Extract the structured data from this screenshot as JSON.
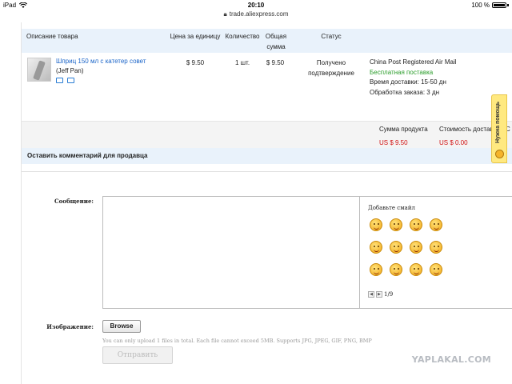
{
  "status_bar": {
    "device": "iPad",
    "time": "20:10",
    "battery": "100 %",
    "url": "trade.aliexpress.com"
  },
  "table": {
    "headers": {
      "description": "Описание товара",
      "unit_price": "Цена за единицу",
      "quantity": "Количество",
      "total_line1": "Общая",
      "total_line2": "сумма",
      "status": "Статус"
    },
    "row": {
      "product_name": "Шприц 150 мл с катетер совет",
      "seller": "(Jeff Pan)",
      "unit_price": "$ 9.50",
      "quantity": "1 шт.",
      "total": "$ 9.50",
      "status_line1": "Получено",
      "status_line2": "подтверждение",
      "shipping_method": "China Post Registered Air Mail",
      "shipping_free": "Бесплатная поставка",
      "delivery_time": "Время доставки: 15-50 дн",
      "processing_time": "Обработка заказа: 3 дн"
    }
  },
  "totals": {
    "product_label": "Сумма продукта",
    "product_value": "US $ 9.50",
    "shipping_label": "Стоимость доставки",
    "shipping_value": "US $ 0.00",
    "extra_label": "С"
  },
  "help_tab": {
    "label": "Нужна помощь"
  },
  "comment": {
    "title": "Оставить комментарий для продавца",
    "message_label": "Сообщение:",
    "emoji_title": "Добавьте смайл",
    "emoji_page": "1/9",
    "image_label": "Изображение:",
    "browse_label": "Browse",
    "upload_hint": "You can only upload 1 files in total. Each file cannot exceed 5MB. Supports JPG, JPEG, GIF, PNG, BMP",
    "submit_label": "Отправить"
  },
  "watermark": "YAPLAKAL.COM"
}
